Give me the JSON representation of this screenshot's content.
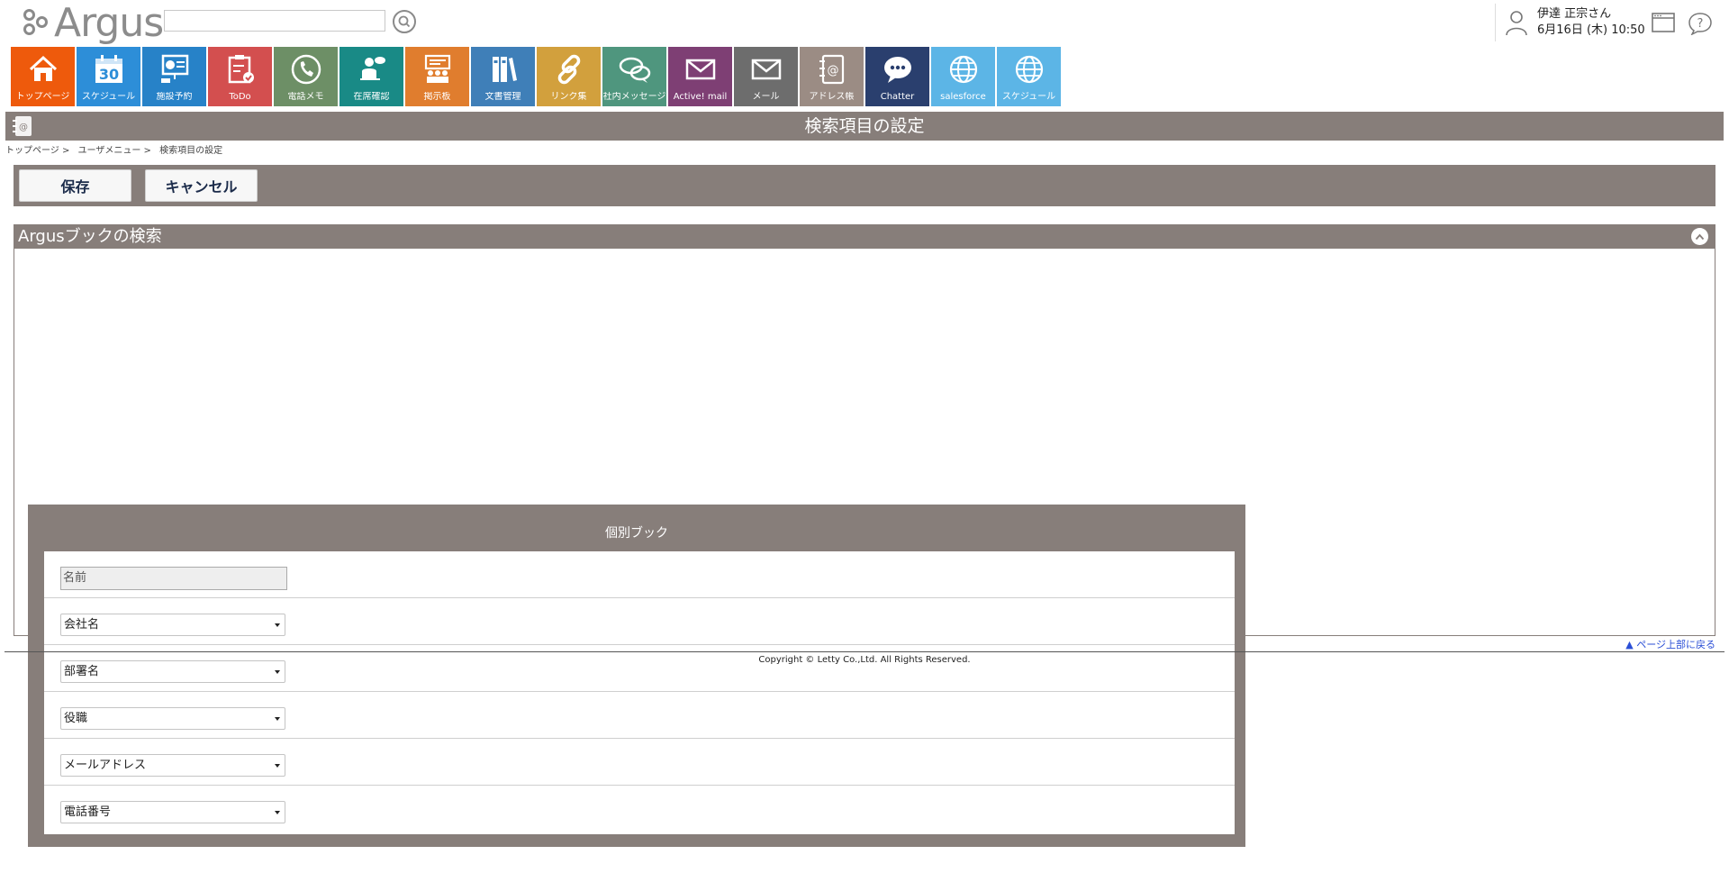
{
  "header": {
    "logo_text": "Argus",
    "search": {
      "value": "",
      "placeholder": ""
    },
    "user": {
      "name": "伊達 正宗さん",
      "datetime": "6月16日 (木) 10:50"
    },
    "icons": {
      "window": "window-icon",
      "help": "help-icon",
      "search": "search-icon"
    }
  },
  "tiles": [
    {
      "label": "トップページ",
      "color": "#ee5a0c",
      "icon": "home-icon"
    },
    {
      "label": "スケジュール",
      "color": "#2d8ed8",
      "icon": "calendar-icon",
      "number": "30"
    },
    {
      "label": "施設予約",
      "color": "#2782c8",
      "icon": "facility-icon"
    },
    {
      "label": "ToDo",
      "color": "#d34f4f",
      "icon": "todo-icon"
    },
    {
      "label": "電話メモ",
      "color": "#6d8f66",
      "icon": "phone-icon"
    },
    {
      "label": "在席確認",
      "color": "#198a86",
      "icon": "presence-icon"
    },
    {
      "label": "掲示板",
      "color": "#e07d2e",
      "icon": "board-icon"
    },
    {
      "label": "文書管理",
      "color": "#3f7fb8",
      "icon": "documents-icon"
    },
    {
      "label": "リンク集",
      "color": "#d2a03d",
      "icon": "link-icon"
    },
    {
      "label": "社内メッセージ",
      "color": "#4f967e",
      "icon": "message-icon"
    },
    {
      "label": "Active! mail",
      "color": "#7e3f74",
      "icon": "mail-icon"
    },
    {
      "label": "メール",
      "color": "#6d6d6d",
      "icon": "mail-icon"
    },
    {
      "label": "アドレス帳",
      "color": "#9b8c84",
      "icon": "address-book-icon"
    },
    {
      "label": "Chatter",
      "color": "#2a3f6e",
      "icon": "chatter-icon"
    },
    {
      "label": "salesforce",
      "color": "#5cb5e6",
      "icon": "globe-icon"
    },
    {
      "label": "スケジュール",
      "color": "#5cb5e6",
      "icon": "globe-icon"
    }
  ],
  "page": {
    "title": "検索項目の設定",
    "breadcrumb": [
      "トップページ >",
      "ユーザメニュー >",
      "検索項目の設定"
    ]
  },
  "actions": {
    "save": "保存",
    "cancel": "キャンセル"
  },
  "section": {
    "title": "Argusブックの検索",
    "panel_title": "個別ブック",
    "name_field": "名前",
    "selects": [
      "会社名",
      "部署名",
      "役職",
      "メールアドレス",
      "電話番号"
    ]
  },
  "footer": {
    "back_to_top": "▲ ページ上部に戻る",
    "copyright": "Copyright © Letty Co.,Ltd. All Rights Reserved."
  }
}
